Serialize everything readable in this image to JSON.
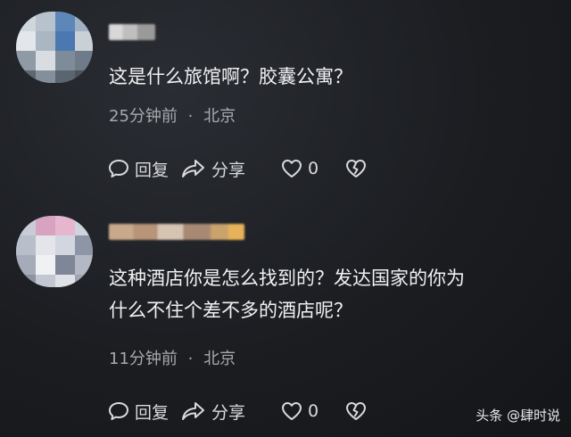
{
  "comments": [
    {
      "text": "这是什么旅馆啊？胶囊公寓？",
      "time": "25分钟前",
      "separator": "·",
      "location": "北京",
      "reply_label": "回复",
      "share_label": "分享",
      "like_count": "0"
    },
    {
      "text_line1": "这种酒店你是怎么找到的？发达国家的你为",
      "text_line2": "什么不住个差不多的酒店呢？",
      "time": "11分钟前",
      "separator": "·",
      "location": "北京",
      "reply_label": "回复",
      "share_label": "分享",
      "like_count": "0"
    }
  ],
  "watermark": "头条 @肆时说",
  "icons": {
    "reply": "comment-bubble-icon",
    "share": "share-arrow-icon",
    "like": "heart-icon",
    "dislike": "broken-heart-icon"
  }
}
